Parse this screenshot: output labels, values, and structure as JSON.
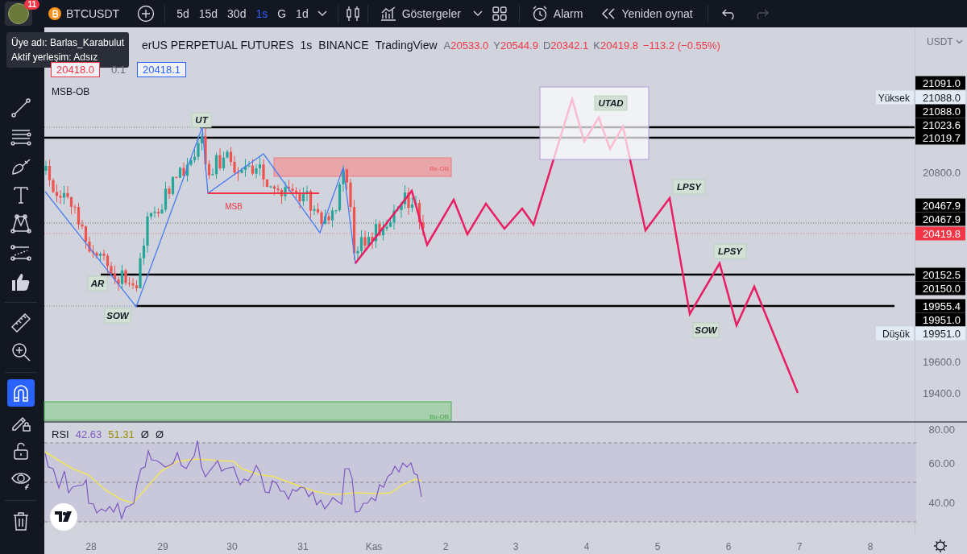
{
  "topbar": {
    "avatar_badge": "11",
    "symbol": "BTCUSDT",
    "intervals": [
      {
        "label": "5d",
        "selected": false
      },
      {
        "label": "15d",
        "selected": false
      },
      {
        "label": "30d",
        "selected": false
      },
      {
        "label": "1s",
        "selected": true
      },
      {
        "label": "G",
        "selected": false
      },
      {
        "label": "1d",
        "selected": false
      }
    ],
    "indicators_label": "Göstergeler",
    "alarm_label": "Alarm",
    "replay_label": "Yeniden oynat",
    "redo_disabled": true
  },
  "tooltip": {
    "lines": [
      "Üye adı: Barlas_Karabulut",
      "Aktif yerleşim: Adsız"
    ]
  },
  "toolbar": {
    "groups": [
      [
        {
          "kind": "trend-line",
          "selected": false
        },
        {
          "kind": "fib",
          "selected": false
        },
        {
          "kind": "brush",
          "selected": false
        },
        {
          "kind": "text",
          "selected": false
        },
        {
          "kind": "pattern",
          "selected": false
        },
        {
          "kind": "prediction",
          "selected": false
        },
        {
          "kind": "thumb",
          "selected": false
        }
      ],
      [
        {
          "kind": "ruler",
          "selected": false
        },
        {
          "kind": "zoom",
          "selected": false
        }
      ],
      [
        {
          "kind": "magnet",
          "selected": true
        },
        {
          "kind": "pencil-lock",
          "selected": false
        },
        {
          "kind": "lock",
          "selected": false
        },
        {
          "kind": "eye",
          "selected": false
        }
      ],
      [
        {
          "kind": "trash",
          "selected": false
        }
      ]
    ]
  },
  "legend": {
    "title": "erUS PERPETUAL FUTURES",
    "interval": "1s",
    "exchange": "BINANCE",
    "source": "TradingView",
    "ohlc": [
      {
        "label": "A",
        "value": "20533.0"
      },
      {
        "label": "Y",
        "value": "20544.9"
      },
      {
        "label": "D",
        "value": "20342.1"
      },
      {
        "label": "K",
        "value": "20419.8"
      }
    ],
    "change": "−113.2 (−0.55%)",
    "bid": "20418.0",
    "spread": "0.1",
    "ask": "20418.1"
  },
  "chart": {
    "indicator_label": "MSB-OB",
    "annotations": [
      {
        "kind": "tag",
        "text": "UT"
      },
      {
        "kind": "tag",
        "text": "AR"
      },
      {
        "kind": "tag",
        "text": "SOW"
      },
      {
        "kind": "note",
        "text": "MSB"
      },
      {
        "kind": "bearish-zone",
        "text": "Be-OB"
      },
      {
        "kind": "bullish-zone",
        "text": "Bu-OB"
      },
      {
        "kind": "tag",
        "text": "UTAD"
      },
      {
        "kind": "tag",
        "text": "LPSY"
      },
      {
        "kind": "tag",
        "text": "LPSY"
      },
      {
        "kind": "tag",
        "text": "SOW"
      }
    ]
  },
  "price_axis": {
    "currency": "USDT",
    "labels": [
      {
        "kind": "marker",
        "text": "21091.0"
      },
      {
        "kind": "high",
        "caption": "Yüksek",
        "text": "21088.0"
      },
      {
        "kind": "marker",
        "text": "21088.0"
      },
      {
        "kind": "marker",
        "text": "21023.6"
      },
      {
        "kind": "marker",
        "text": "21019.7"
      },
      {
        "kind": "tick",
        "text": "20800.0"
      },
      {
        "kind": "marker",
        "text": "20467.9"
      },
      {
        "kind": "marker",
        "text": "20467.9"
      },
      {
        "kind": "current",
        "text": "20419.8"
      },
      {
        "kind": "marker",
        "text": "20152.5"
      },
      {
        "kind": "marker",
        "text": "20150.0"
      },
      {
        "kind": "marker",
        "text": "19955.4"
      },
      {
        "kind": "marker",
        "text": "19951.0"
      },
      {
        "kind": "low",
        "caption": "Düşük",
        "text": "19951.0"
      },
      {
        "kind": "tick",
        "text": "19600.0"
      },
      {
        "kind": "tick",
        "text": "19400.0"
      }
    ]
  },
  "rsi": {
    "label": "RSI",
    "value": "42.63",
    "average": "51.31",
    "extras": [
      "Ø",
      "Ø"
    ],
    "axis": [
      "80.00",
      "60.00",
      "40.00"
    ]
  },
  "time_axis": [
    "28",
    "29",
    "30",
    "31",
    "Kas",
    "2",
    "3",
    "4",
    "5",
    "6",
    "7",
    "8"
  ]
}
